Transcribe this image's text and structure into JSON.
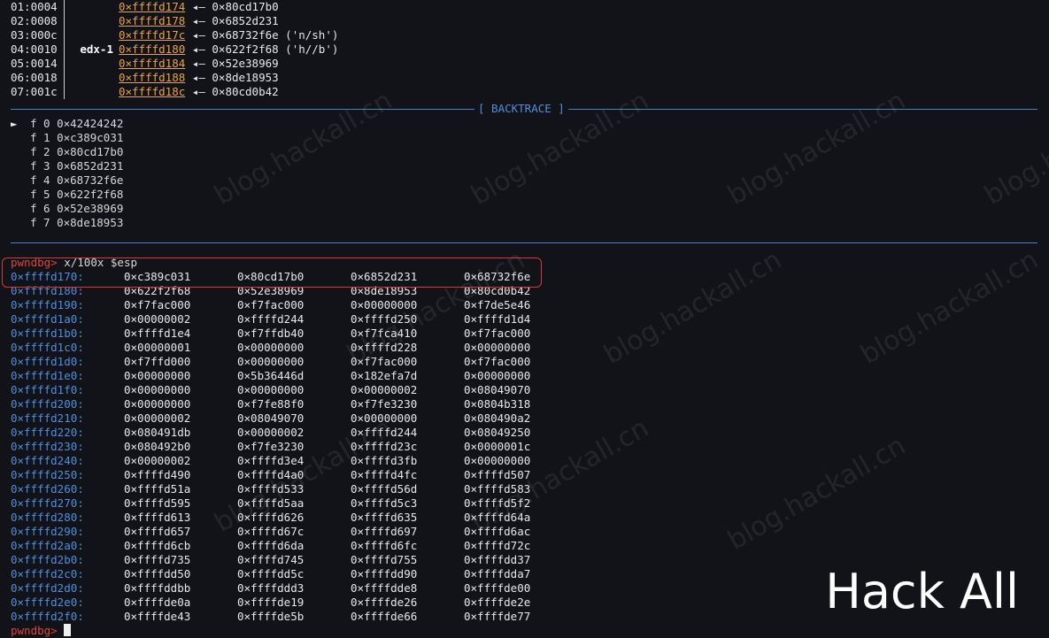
{
  "stack_lines": [
    {
      "idx": "01:0004",
      "reg": "",
      "addr": "0×ffffd174",
      "arrow": "◂—",
      "val": "0×80cd17b0"
    },
    {
      "idx": "02:0008",
      "reg": "",
      "addr": "0×ffffd178",
      "arrow": "◂—",
      "val": "0×6852d231"
    },
    {
      "idx": "03:000c",
      "reg": "",
      "addr": "0×ffffd17c",
      "arrow": "◂—",
      "val": "0×68732f6e ('n/sh')"
    },
    {
      "idx": "04:0010",
      "reg": "edx-1",
      "addr": "0×ffffd180",
      "arrow": "◂—",
      "val": "0×622f2f68 ('h//b')"
    },
    {
      "idx": "05:0014",
      "reg": "",
      "addr": "0×ffffd184",
      "arrow": "◂—",
      "val": "0×52e38969"
    },
    {
      "idx": "06:0018",
      "reg": "",
      "addr": "0×ffffd188",
      "arrow": "◂—",
      "val": "0×8de18953"
    },
    {
      "idx": "07:001c",
      "reg": "",
      "addr": "0×ffffd18c",
      "arrow": "◂—",
      "val": "0×80cd0b42"
    }
  ],
  "backtrace_label": "[ BACKTRACE ]",
  "backtrace": [
    {
      "marker": "►",
      "frame": "f 0",
      "addr": "0×42424242"
    },
    {
      "marker": "",
      "frame": "f 1",
      "addr": "0×c389c031"
    },
    {
      "marker": "",
      "frame": "f 2",
      "addr": "0×80cd17b0"
    },
    {
      "marker": "",
      "frame": "f 3",
      "addr": "0×6852d231"
    },
    {
      "marker": "",
      "frame": "f 4",
      "addr": "0×68732f6e"
    },
    {
      "marker": "",
      "frame": "f 5",
      "addr": "0×622f2f68"
    },
    {
      "marker": "",
      "frame": "f 6",
      "addr": "0×52e38969"
    },
    {
      "marker": "",
      "frame": "f 7",
      "addr": "0×8de18953"
    }
  ],
  "prompt": "pwndbg>",
  "command": " x/100x $esp",
  "memory": [
    {
      "addr": "0×ffffd170:",
      "w": [
        "0×c389c031",
        "0×80cd17b0",
        "0×6852d231",
        "0×68732f6e"
      ]
    },
    {
      "addr": "0×ffffd180:",
      "w": [
        "0×622f2f68",
        "0×52e38969",
        "0×8de18953",
        "0×80cd0b42"
      ]
    },
    {
      "addr": "0×ffffd190:",
      "w": [
        "0×f7fac000",
        "0×f7fac000",
        "0×00000000",
        "0×f7de5e46"
      ]
    },
    {
      "addr": "0×ffffd1a0:",
      "w": [
        "0×00000002",
        "0×ffffd244",
        "0×ffffd250",
        "0×ffffd1d4"
      ]
    },
    {
      "addr": "0×ffffd1b0:",
      "w": [
        "0×ffffd1e4",
        "0×f7ffdb40",
        "0×f7fca410",
        "0×f7fac000"
      ]
    },
    {
      "addr": "0×ffffd1c0:",
      "w": [
        "0×00000001",
        "0×00000000",
        "0×ffffd228",
        "0×00000000"
      ]
    },
    {
      "addr": "0×ffffd1d0:",
      "w": [
        "0×f7ffd000",
        "0×00000000",
        "0×f7fac000",
        "0×f7fac000"
      ]
    },
    {
      "addr": "0×ffffd1e0:",
      "w": [
        "0×00000000",
        "0×5b36446d",
        "0×182efa7d",
        "0×00000000"
      ]
    },
    {
      "addr": "0×ffffd1f0:",
      "w": [
        "0×00000000",
        "0×00000000",
        "0×00000002",
        "0×08049070"
      ]
    },
    {
      "addr": "0×ffffd200:",
      "w": [
        "0×00000000",
        "0×f7fe88f0",
        "0×f7fe3230",
        "0×0804b318"
      ]
    },
    {
      "addr": "0×ffffd210:",
      "w": [
        "0×00000002",
        "0×08049070",
        "0×00000000",
        "0×080490a2"
      ]
    },
    {
      "addr": "0×ffffd220:",
      "w": [
        "0×080491db",
        "0×00000002",
        "0×ffffd244",
        "0×08049250"
      ]
    },
    {
      "addr": "0×ffffd230:",
      "w": [
        "0×080492b0",
        "0×f7fe3230",
        "0×ffffd23c",
        "0×0000001c"
      ]
    },
    {
      "addr": "0×ffffd240:",
      "w": [
        "0×00000002",
        "0×ffffd3e4",
        "0×ffffd3fb",
        "0×00000000"
      ]
    },
    {
      "addr": "0×ffffd250:",
      "w": [
        "0×ffffd490",
        "0×ffffd4a0",
        "0×ffffd4fc",
        "0×ffffd507"
      ]
    },
    {
      "addr": "0×ffffd260:",
      "w": [
        "0×ffffd51a",
        "0×ffffd533",
        "0×ffffd56d",
        "0×ffffd583"
      ]
    },
    {
      "addr": "0×ffffd270:",
      "w": [
        "0×ffffd595",
        "0×ffffd5aa",
        "0×ffffd5c3",
        "0×ffffd5f2"
      ]
    },
    {
      "addr": "0×ffffd280:",
      "w": [
        "0×ffffd613",
        "0×ffffd626",
        "0×ffffd635",
        "0×ffffd64a"
      ]
    },
    {
      "addr": "0×ffffd290:",
      "w": [
        "0×ffffd657",
        "0×ffffd67c",
        "0×ffffd697",
        "0×ffffd6ac"
      ]
    },
    {
      "addr": "0×ffffd2a0:",
      "w": [
        "0×ffffd6cb",
        "0×ffffd6da",
        "0×ffffd6fc",
        "0×ffffd72c"
      ]
    },
    {
      "addr": "0×ffffd2b0:",
      "w": [
        "0×ffffd735",
        "0×ffffd745",
        "0×ffffd755",
        "0×ffffdd37"
      ]
    },
    {
      "addr": "0×ffffd2c0:",
      "w": [
        "0×ffffdd50",
        "0×ffffdd5c",
        "0×ffffdd90",
        "0×ffffdda7"
      ]
    },
    {
      "addr": "0×ffffd2d0:",
      "w": [
        "0×ffffddbb",
        "0×ffffddd3",
        "0×ffffdde8",
        "0×ffffde00"
      ]
    },
    {
      "addr": "0×ffffd2e0:",
      "w": [
        "0×ffffde0a",
        "0×ffffde19",
        "0×ffffde26",
        "0×ffffde2e"
      ]
    },
    {
      "addr": "0×ffffd2f0:",
      "w": [
        "0×ffffde43",
        "0×ffffde5b",
        "0×ffffde66",
        "0×ffffde77"
      ]
    }
  ],
  "final_prompt": "pwndbg>",
  "watermark": "blog.hackall.cn",
  "brand": "Hack All"
}
